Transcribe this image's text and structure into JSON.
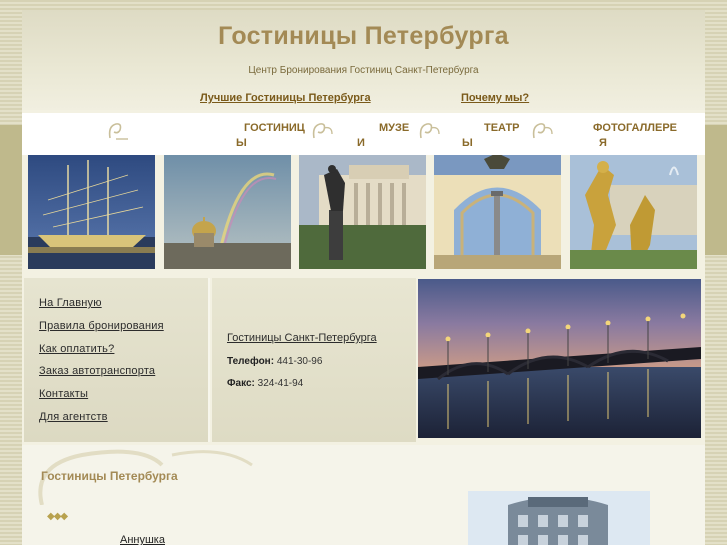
{
  "header": {
    "title": "Гостиницы Петербурга",
    "subtitle": "Центр Бронирования Гостиниц Санкт-Петербурга",
    "links": [
      "Лучшие Гостиницы Петербурга",
      "Почему мы?"
    ]
  },
  "nav": {
    "items": [
      {
        "line1": "ГОСТИНИЦ",
        "line2": "Ы"
      },
      {
        "line1": "МУЗЕ",
        "line2": "И"
      },
      {
        "line1": "ТЕАТР",
        "line2": "Ы"
      },
      {
        "line1": "ФОТОГАЛЛЕРЕ",
        "line2": "Я"
      }
    ]
  },
  "photos": [
    "sailship-photo",
    "rainbow-cathedral-photo",
    "pushkin-monument-photo",
    "general-staff-arch-photo",
    "peterhof-fountain-photo"
  ],
  "menu": {
    "items": [
      "На Главную",
      "Правила бронирования",
      "Как оплатить?",
      "Заказ автотранспорта",
      "Контакты",
      "Для агентств"
    ]
  },
  "contact": {
    "title": "Гостиницы Санкт-Петербурга",
    "phone_label": "Телефон:",
    "phone": "441-30-96",
    "fax_label": "Факс:",
    "fax": "324-41-94"
  },
  "lower": {
    "section_title": "Гостиницы Петербурга",
    "stars": "◆◆◆",
    "hotel_name": "Аннушка"
  },
  "colors": {
    "accent_gold": "#a38a55",
    "link_brown": "#7a5a1a",
    "background": "#f3f1e2"
  }
}
